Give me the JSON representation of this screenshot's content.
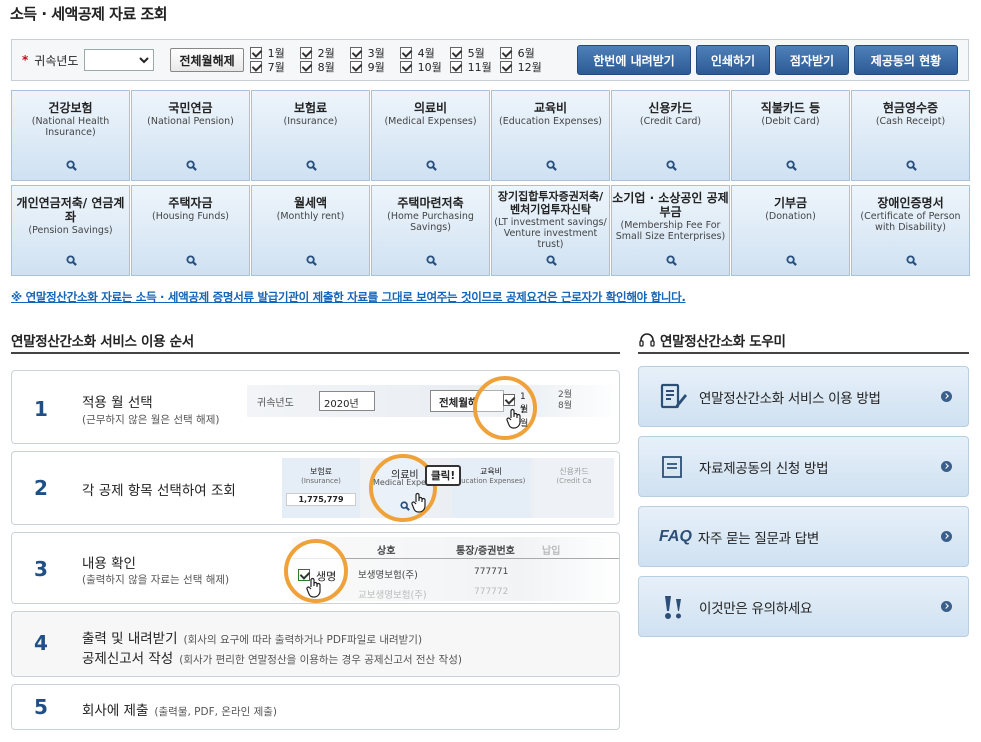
{
  "page_title": "소득 · 세액공제 자료 조회",
  "filter": {
    "year_label": "귀속년도",
    "year_value": "",
    "toggle_all": "전체월해제",
    "months": [
      "1월",
      "2월",
      "3월",
      "4월",
      "5월",
      "6월",
      "7월",
      "8월",
      "9월",
      "10월",
      "11월",
      "12월"
    ],
    "actions": [
      "한번에 내려받기",
      "인쇄하기",
      "점자받기",
      "제공동의 현황"
    ]
  },
  "tiles_row1": [
    {
      "ko": "건강보험",
      "en": "(National Health Insurance)"
    },
    {
      "ko": "국민연금",
      "en": "(National Pension)"
    },
    {
      "ko": "보험료",
      "en": "(Insurance)"
    },
    {
      "ko": "의료비",
      "en": "(Medical Expenses)"
    },
    {
      "ko": "교육비",
      "en": "(Education Expenses)"
    },
    {
      "ko": "신용카드",
      "en": "(Credit Card)"
    },
    {
      "ko": "직불카드 등",
      "en": "(Debit Card)"
    },
    {
      "ko": "현금영수증",
      "en": "(Cash Receipt)"
    }
  ],
  "tiles_row2": [
    {
      "ko": "개인연금저축/ 연금계좌",
      "en": "(Pension Savings)"
    },
    {
      "ko": "주택자금",
      "en": "(Housing Funds)"
    },
    {
      "ko": "월세액",
      "en": "(Monthly rent)"
    },
    {
      "ko": "주택마련저축",
      "en": "(Home Purchasing Savings)"
    },
    {
      "ko": "장기집합투자증권저축/ 벤처기업투자신탁",
      "en": "(LT investment savings/ Venture investment trust)"
    },
    {
      "ko": "소기업 · 소상공인 공제부금",
      "en": "(Membership Fee For Small Size Enterprises)"
    },
    {
      "ko": "기부금",
      "en": "(Donation)"
    },
    {
      "ko": "장애인증명서",
      "en": "(Certificate of Person with Disability)"
    }
  ],
  "notice": "※ 연말정산간소화 자료는 소득 · 세액공제 증명서류 발급기관이 제출한 자료를 그대로 보여주는 것이므로 공제요건은 근로자가 확인해야 합니다.",
  "steps_title": "연말정산간소화 서비스 이용 순서",
  "steps": [
    {
      "num": "1",
      "title": "적용 월 선택",
      "sub": "(근무하지 않은 월은 선택 해제)"
    },
    {
      "num": "2",
      "title": "각 공제 항목 선택하여 조회",
      "sub": ""
    },
    {
      "num": "3",
      "title": "내용 확인",
      "sub": "(출력하지 않을 자료는 선택 해제)"
    },
    {
      "num": "4",
      "title": "출력 및 내려받기",
      "sub": "(회사의 요구에 따라 출력하거나 PDF파일로 내려받기)",
      "title2": "공제신고서 작성",
      "sub2": "(회사가 편리한 연말정산을 이용하는 경우 공제신고서 전산 작성)"
    },
    {
      "num": "5",
      "title": "회사에 제출",
      "sub": "(출력물, PDF, 온라인 제출)"
    }
  ],
  "illus": {
    "s1_label": "귀속년도",
    "s1_year": "2020년",
    "s1_btn": "전체월해",
    "s1_m1": "1월",
    "s1_m2": "2월",
    "s1_m7": "7월",
    "s1_m8": "8월",
    "s2_tile1_ko": "보험료",
    "s2_tile1_en": "(Insurance)",
    "s2_value": "1,775,779",
    "s2_tile2_ko": "의료비",
    "s2_tile2_en": "Medical Expen",
    "s2_tile3_ko": "교육비",
    "s2_tile3_en": "ducation Expenses)",
    "s2_tile4_ko": "신용카드",
    "s2_tile4_en": "(Credit Ca",
    "s2_click": "클릭!",
    "s3_col1": "상호",
    "s3_col2": "통장/증권번호",
    "s3_col3": "납입",
    "s3_row1_name": "생명",
    "s3_row1_co": "보생명보험(주)",
    "s3_row1_acct": "777771",
    "s3_row2_co": "교보생명보험(주)",
    "s3_row2_acct": "777772"
  },
  "helper_title": "연말정산간소화 도우미",
  "helper_items": [
    {
      "icon": "document-pen-icon",
      "label": "연말정산간소화 서비스 이용 방법"
    },
    {
      "icon": "document-icon",
      "label": "자료제공동의 신청 방법"
    },
    {
      "icon": "faq-icon",
      "label": "자주 묻는 질문과 답변",
      "prefix": "FAQ"
    },
    {
      "icon": "exclamation-icon",
      "label": "이것만은 유의하세요"
    }
  ]
}
